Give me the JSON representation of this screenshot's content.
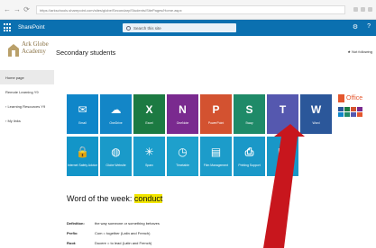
{
  "browser": {
    "url": "https://arkschools.sharepoint.com/sites/globe/Secondary/Students/SitePages/Home.aspx",
    "nav": [
      "←",
      "→",
      "⟳"
    ]
  },
  "suite": {
    "app_name": "SharePoint",
    "search_placeholder": "Search this site",
    "right_icons": [
      "⚙",
      "?"
    ]
  },
  "site": {
    "logo_line1": "Ark Globe",
    "logo_line2": "Academy",
    "page_title": "Secondary students",
    "follow_label": "★ Not following"
  },
  "left_nav": {
    "items": [
      {
        "label": "Home page",
        "active": true
      },
      {
        "label": "Remote Learning Y9",
        "active": false
      },
      {
        "label": "› Learning Resources Y9",
        "active": false
      },
      {
        "label": "› My links",
        "active": false
      }
    ]
  },
  "tiles": {
    "row1": [
      {
        "label": "Email",
        "color": "#0f86c9",
        "icon": "mail-icon",
        "glyph": "✉"
      },
      {
        "label": "OneDrive",
        "color": "#1386c7",
        "icon": "cloud-icon",
        "glyph": "☁"
      },
      {
        "label": "Excel",
        "color": "#1c7a42",
        "icon": "excel-icon",
        "glyph": "X"
      },
      {
        "label": "OneNote",
        "color": "#7a2a8f",
        "icon": "onenote-icon",
        "glyph": "N"
      },
      {
        "label": "PowerPoint",
        "color": "#d35230",
        "icon": "powerpoint-icon",
        "glyph": "P"
      },
      {
        "label": "Sway",
        "color": "#1f8a68",
        "icon": "sway-icon",
        "glyph": "S"
      },
      {
        "label": "",
        "color": "#5558af",
        "icon": "teams-icon",
        "glyph": "T"
      },
      {
        "label": "Word",
        "color": "#2b579a",
        "icon": "word-icon",
        "glyph": "W"
      }
    ],
    "row2": [
      {
        "label": "Internet Safety Advice",
        "color": "#1395c8",
        "icon": "lock-icon",
        "glyph": "🔒"
      },
      {
        "label": "Globe Website",
        "color": "#1a9ac9",
        "icon": "globe-icon",
        "glyph": "◍"
      },
      {
        "label": "Sparx",
        "color": "#1b9dcb",
        "icon": "sparkle-icon",
        "glyph": "✳"
      },
      {
        "label": "Timetable",
        "color": "#1ea0cc",
        "icon": "clock-icon",
        "glyph": "◷"
      },
      {
        "label": "Film Management",
        "color": "#1c9cca",
        "icon": "film-icon",
        "glyph": "▤"
      },
      {
        "label": "Printing Support",
        "color": "#1a98c8",
        "icon": "printer-icon",
        "glyph": "⎙"
      },
      {
        "label": "",
        "color": "#1997c7",
        "icon": "document-icon",
        "glyph": "▦"
      }
    ]
  },
  "office": {
    "label": "Office",
    "mini_colors": [
      "#2b579a",
      "#1c7a42",
      "#d35230",
      "#7a2a8f",
      "#0f86c9",
      "#1f8a68",
      "#5558af",
      "#e4572e"
    ]
  },
  "word_of_week": {
    "heading": "Word of the week: ",
    "word": "conduct",
    "definitions": [
      {
        "key": "Definition:",
        "value": "the way someone or something behaves"
      },
      {
        "key": "Prefix:",
        "value": "Com = together (Latin and French)"
      },
      {
        "key": "Root:",
        "value": "Ducere = to lead (Latin and French)"
      }
    ]
  },
  "colors": {
    "suite_bar": "#0b70b0",
    "arrow": "#c8161d",
    "highlight": "#f2e600"
  }
}
